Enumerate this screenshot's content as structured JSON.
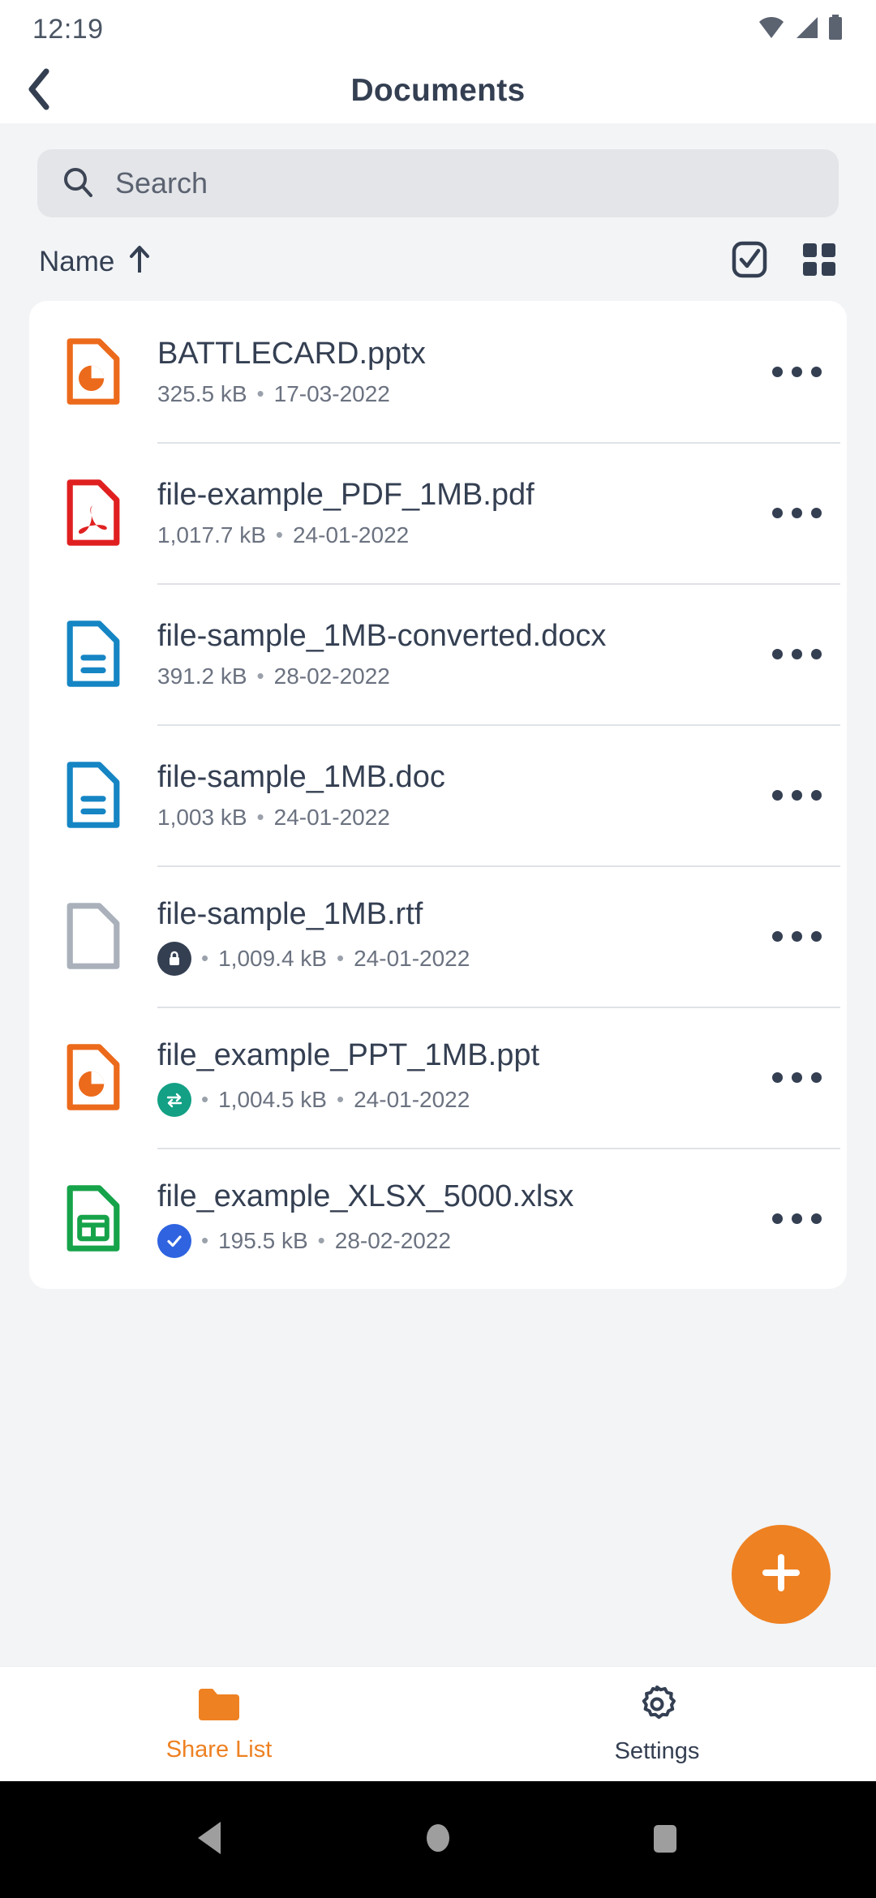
{
  "status_bar": {
    "time": "12:19",
    "icons": [
      "wifi-icon",
      "cellular-signal-icon",
      "battery-icon"
    ]
  },
  "app_bar": {
    "back_icon": "chevron-left-icon",
    "title": "Documents"
  },
  "search": {
    "icon": "search-icon",
    "placeholder": "Search",
    "value": ""
  },
  "sort": {
    "label": "Name",
    "direction_icon": "arrow-up-icon",
    "select_icon": "checkbox-square-icon",
    "view_icon": "grid-view-icon"
  },
  "files": [
    {
      "name": "BATTLECARD.pptx",
      "size": "325.5 kB",
      "date": "17-03-2022",
      "icon": "powerpoint-file-icon",
      "icon_color": "#ec6a1b",
      "badge": null,
      "more_icon": "more-horizontal-icon"
    },
    {
      "name": "file-example_PDF_1MB.pdf",
      "size": "1,017.7 kB",
      "date": "24-01-2022",
      "icon": "pdf-file-icon",
      "icon_color": "#e02020",
      "badge": null,
      "more_icon": "more-horizontal-icon"
    },
    {
      "name": "file-sample_1MB-converted.docx",
      "size": "391.2 kB",
      "date": "28-02-2022",
      "icon": "word-file-icon",
      "icon_color": "#1585c4",
      "badge": null,
      "more_icon": "more-horizontal-icon"
    },
    {
      "name": "file-sample_1MB.doc",
      "size": "1,003 kB",
      "date": "24-01-2022",
      "icon": "word-file-icon",
      "icon_color": "#1585c4",
      "badge": null,
      "more_icon": "more-horizontal-icon"
    },
    {
      "name": "file-sample_1MB.rtf",
      "size": "1,009.4 kB",
      "date": "24-01-2022",
      "icon": "generic-file-icon",
      "icon_color": "#aab1bb",
      "badge": "lock-badge-icon",
      "badge_color": "#343f52",
      "more_icon": "more-horizontal-icon"
    },
    {
      "name": "file_example_PPT_1MB.ppt",
      "size": "1,004.5 kB",
      "date": "24-01-2022",
      "icon": "powerpoint-file-icon",
      "icon_color": "#ec6a1b",
      "badge": "sync-badge-icon",
      "badge_color": "#13a085",
      "more_icon": "more-horizontal-icon"
    },
    {
      "name": "file_example_XLSX_5000.xlsx",
      "size": "195.5 kB",
      "date": "28-02-2022",
      "icon": "excel-file-icon",
      "icon_color": "#16a34a",
      "badge": "check-badge-icon",
      "badge_color": "#2f63e0",
      "more_icon": "more-horizontal-icon"
    }
  ],
  "fab": {
    "icon": "plus-icon",
    "color": "#ee8122"
  },
  "bottom_nav": [
    {
      "label": "Share List",
      "icon": "folder-icon",
      "active": true
    },
    {
      "label": "Settings",
      "icon": "gear-icon",
      "active": false
    }
  ],
  "android_nav": {
    "back_icon": "triangle-back-icon",
    "home_icon": "circle-home-icon",
    "recents_icon": "square-recents-icon"
  },
  "separator_dot": "•",
  "colors": {
    "accent": "#ee8122",
    "page_bg": "#f2f4f6",
    "card_bg": "#ffffff",
    "text_primary": "#343f52",
    "text_secondary": "#6b7280"
  }
}
